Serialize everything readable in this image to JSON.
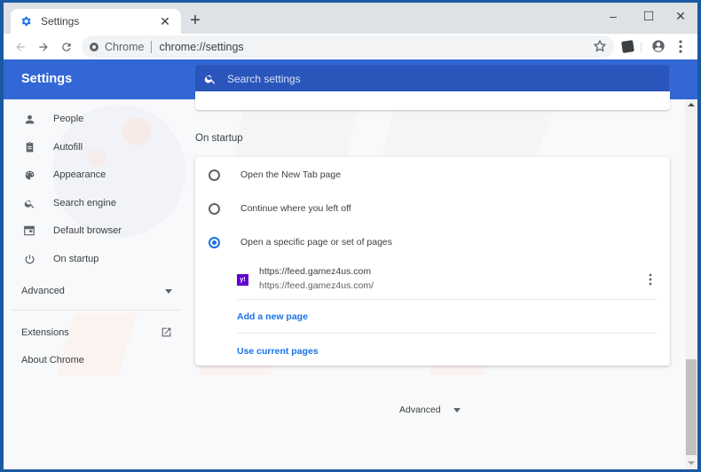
{
  "browser": {
    "tab_title": "Settings",
    "tab_close": "✕",
    "new_tab": "+",
    "window_controls": {
      "minimize": "–",
      "maximize": "☐",
      "close": "✕"
    },
    "omnibox": {
      "site_label": "Chrome",
      "url": "chrome://settings"
    }
  },
  "header": {
    "title": "Settings",
    "search_placeholder": "Search settings"
  },
  "sidebar": {
    "items": [
      {
        "label": "People",
        "icon": "person-icon"
      },
      {
        "label": "Autofill",
        "icon": "clipboard-icon"
      },
      {
        "label": "Appearance",
        "icon": "palette-icon"
      },
      {
        "label": "Search engine",
        "icon": "search-icon"
      },
      {
        "label": "Default browser",
        "icon": "browser-window-icon"
      },
      {
        "label": "On startup",
        "icon": "power-icon"
      }
    ],
    "advanced_label": "Advanced",
    "extensions_label": "Extensions",
    "about_label": "About Chrome"
  },
  "main": {
    "section_title": "On startup",
    "options": [
      {
        "label": "Open the New Tab page",
        "selected": false
      },
      {
        "label": "Continue where you left off",
        "selected": false
      },
      {
        "label": "Open a specific page or set of pages",
        "selected": true
      }
    ],
    "startup_page": {
      "title": "https://feed.gamez4us.com",
      "url": "https://feed.gamez4us.com/",
      "favicon_text": "y!",
      "favicon_color": "#6001d2"
    },
    "add_page_label": "Add a new page",
    "use_current_label": "Use current pages",
    "advanced_label": "Advanced"
  },
  "colors": {
    "header_blue": "#3367d6",
    "accent": "#1a73e8"
  }
}
